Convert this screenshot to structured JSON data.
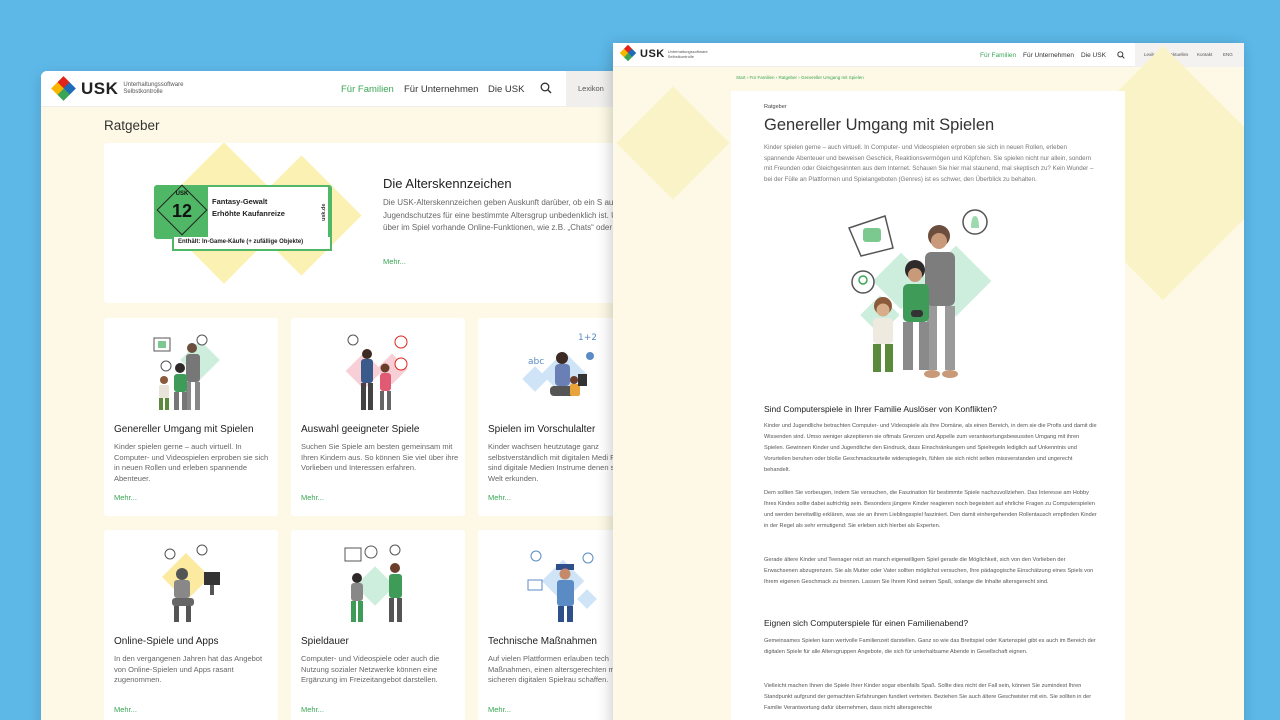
{
  "brand": {
    "name": "USK",
    "subtitle_line1": "Unterhaltungssoftware",
    "subtitle_line2": "Selbstkontrolle",
    "colors": {
      "red": "#e2231a",
      "yellow": "#f7b500",
      "green": "#3aa655",
      "blue": "#1e6bb8"
    }
  },
  "back": {
    "nav": {
      "families": "Für Familien",
      "companies": "Für Unternehmen",
      "usk": "Die USK",
      "lexikon": "Lexikon"
    },
    "search_icon": "search-icon",
    "page_title": "Ratgeber",
    "hero": {
      "badge_usk": "USK",
      "badge_age": "12",
      "badge_desc1": "Fantasy-Gewalt",
      "badge_desc2": "Erhöhte Kaufanreize",
      "badge_side": "usk.de",
      "badge_foot": "Enthält: In-Game-Käufe (+ zufällige Objekte)",
      "title": "Die Alterskennzeichen",
      "text": "Die USK-Alterskennzeichen geben Auskunft darüber, ob ein S aus Sicht des Jugendschutzes für eine bestimmte Altersgrup unbedenklich ist. Und sie informieren über im Spiel vorhande Online-Funktionen, wie z.B. „Chats“ oder „In-Game-Käufe“.",
      "more": "Mehr..."
    },
    "cards": [
      {
        "title": "Genereller Umgang mit Spielen",
        "text": "Kinder spielen gerne – auch virtuell. In Computer- und Videospielen erproben sie sich in neuen Rollen und erleben spannende Abenteuer.",
        "more": "Mehr..."
      },
      {
        "title": "Auswahl geeigneter Spiele",
        "text": "Suchen Sie Spiele am besten gemeinsam mit Ihren Kindern aus. So können Sie viel über ihre Vorlieben und Interessen erfahren.",
        "more": "Mehr..."
      },
      {
        "title": "Spielen im Vorschulalter",
        "text": "Kinder wachsen heutzutage ganz selbstverständlich mit digitalen Medi Für sie sind digitale Medien Instrume denen sie die Welt erkunden.",
        "more": "Mehr..."
      },
      {
        "title": "Online-Spiele und Apps",
        "text": "In den vergangenen Jahren hat das Angebot von Online-Spielen und Apps rasant zugenommen.",
        "more": "Mehr..."
      },
      {
        "title": "Spieldauer",
        "text": "Computer- und Videospiele oder auch die Nutzung sozialer Netzwerke können eine Ergänzung im Freizeitangebot darstellen.",
        "more": "Mehr..."
      },
      {
        "title": "Technische Maßnahmen",
        "text": "Auf vielen Plattformen erlauben tech Maßnahmen, einen altersgerechten möglichst sicheren digitalen Spielrau schaffen.",
        "more": "Mehr..."
      }
    ]
  },
  "front": {
    "nav": {
      "families": "Für Familien",
      "companies": "Für Unternehmen",
      "usk": "Die USK"
    },
    "util": {
      "lexikon": "Lexikon",
      "news": "Aktuelles",
      "contact": "Kontakt",
      "lang": "ENG"
    },
    "breadcrumb": "Start › Für Familien › Ratgeber › Genereller Umgang mit Spielen",
    "kicker": "Ratgeber",
    "title": "Genereller Umgang mit Spielen",
    "lead": "Kinder spielen gerne – auch virtuell. In Computer- und Videospielen erproben sie sich in neuen Rollen, erleben spannende Abenteuer und beweisen Geschick, Reaktionsvermögen und Köpfchen. Sie spielen nicht nur allein, sondern mit Freunden oder Gleichgesinnten aus dem Internet. Schauen Sie hier mal staunend, mal skeptisch zu? Kein Wunder – bei der Fülle an Plattformen und Spielangeboten (Genres) ist es schwer, den Überblick zu behalten.",
    "h1": "Sind Computerspiele in Ihrer Familie Auslöser von Konflikten?",
    "p1": "Kinder und Jugendliche betrachten Computer- und Videospiele als ihre Domäne, als einen Bereich, in dem sie die Profis und damit die Wissenden sind. Umso weniger akzeptieren sie oftmals Grenzen und Appelle zum verantwortungsbewussten Umgang mit ihren Spielen. Gewinnen Kinder und Jugendliche den Eindruck, dass Einschränkungen und Spielregeln lediglich auf Unkenntnis und Vorurteilen beruhen oder bloße Geschmacksurteile widerspiegeln, fühlen sie sich nicht selten missverstanden und ungerecht behandelt.",
    "p2": "Dem sollten Sie vorbeugen, indem Sie versuchen, die Faszination für bestimmte Spiele nachzuvollziehen. Das Interesse am Hobby Ihres Kindes sollte dabei aufrichtig sein. Besonders jüngere Kinder reagieren noch begeistert auf ehrliche Fragen zu Computerspielen und werden bereitwillig erklären, was sie an ihrem Lieblingsspiel fasziniert. Den damit einhergehenden Rollentausch empfinden Kinder in der Regel als sehr ermutigend: Sie erleben sich hierbei als Experten.",
    "p3": "Gerade ältere Kinder und Teenager reizt an manch eigenwilligem Spiel gerade die Möglichkeit, sich von den Vorlieben der Erwachsenen abzugrenzen. Sie als Mutter oder Vater sollten möglichst versuchen, Ihre pädagogische Einschätzung eines Spiels von Ihrem eigenen Geschmack zu trennen. Lassen Sie Ihrem Kind seinen Spaß, solange die Inhalte altersgerecht sind.",
    "h2": "Eignen sich Computerspiele für einen Familienabend?",
    "p4": "Gemeinsames Spielen kann wertvolle Familienzeit darstellen. Ganz so wie das Brettspiel oder Kartenspiel gibt es auch im Bereich der digitalen Spiele für alle Altersgruppen Angebote, die sich für unterhaltsame Abende in Gesellschaft eignen.",
    "p5": "Vielleicht machen Ihnen die Spiele Ihrer Kinder sogar ebenfalls Spaß. Sollte dies nicht der Fall sein, können Sie zumindest Ihren Standpunkt aufgrund der gemachten Erfahrungen fundiert vertreten. Beziehen Sie auch ältere Geschwister mit ein. Sie sollten in der Familie Verantwortung dafür übernehmen, dass nicht altersgerechte"
  }
}
